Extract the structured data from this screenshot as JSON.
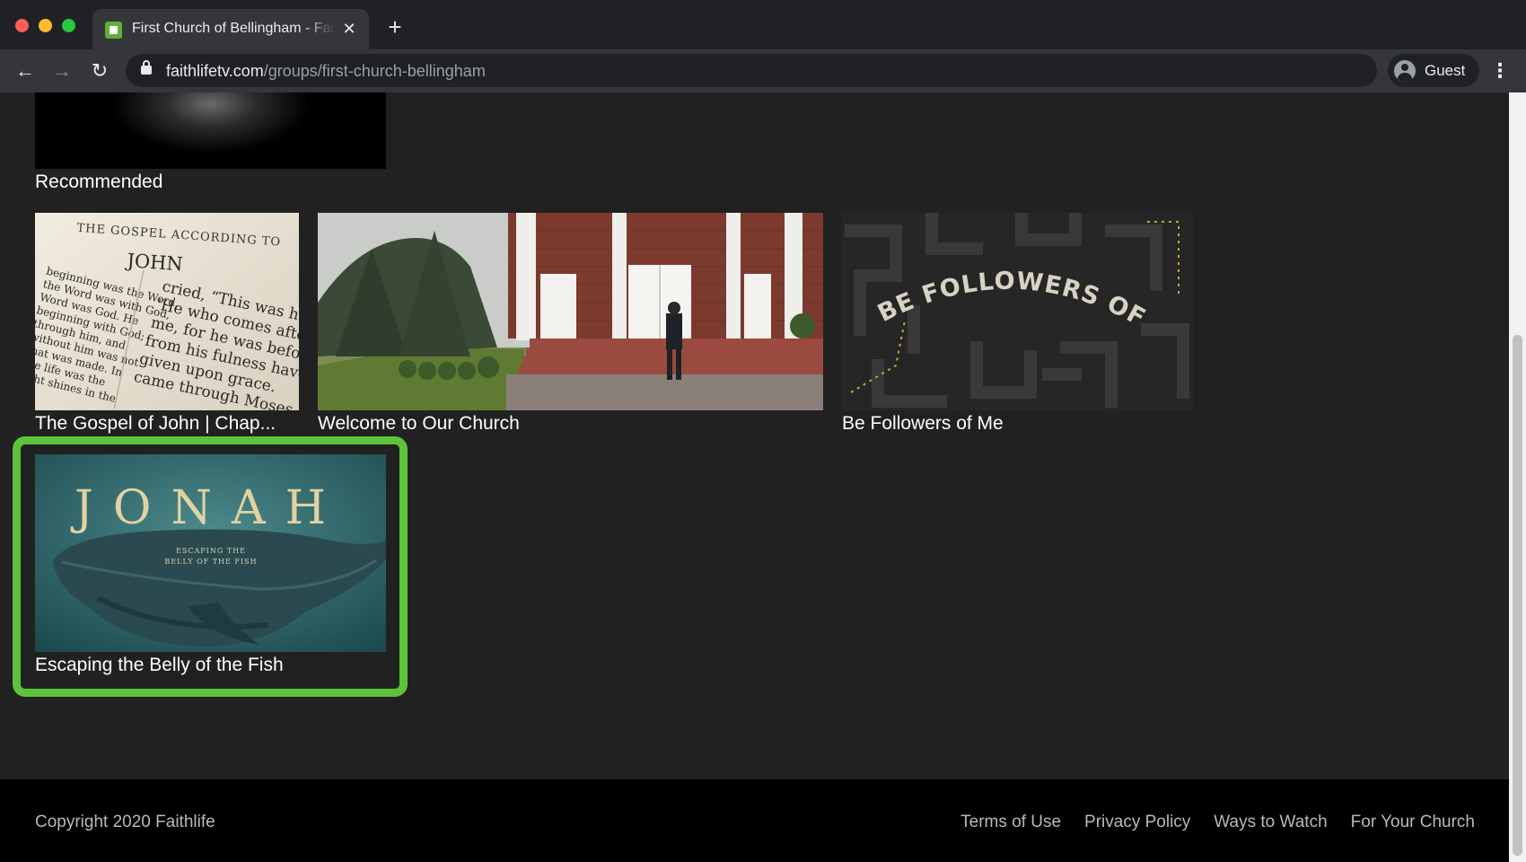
{
  "browser": {
    "tab_title": "First Church of Bellingham - Faithlife TV",
    "tab_close_glyph": "✕",
    "new_tab_glyph": "+",
    "url_domain": "faithlifetv.com",
    "url_path": "/groups/first-church-bellingham",
    "profile_label": "Guest",
    "back_glyph": "←",
    "forward_glyph": "→",
    "reload_glyph": "↻",
    "menu_glyph": "⋮"
  },
  "section": {
    "title": "Recommended"
  },
  "cards": [
    {
      "title": "The Gospel of John | Chap...",
      "art": "bible-page"
    },
    {
      "title": "Welcome to Our Church",
      "art": "church-entrance"
    },
    {
      "title": "Be Followers of Me",
      "art": "maze-lettering"
    },
    {
      "title": "Escaping the Belly of the Fish",
      "art": "whale-jonah",
      "highlighted": true
    }
  ],
  "thumb_text": {
    "bible_header": "THE GOSPEL ACCORDING TO",
    "bible_book": "JOHN",
    "bible_lines": [
      "cried, “This was he",
      "'He who comes after",
      "me, for he was before",
      "from his fulness have",
      "given upon grace.",
      "came through Moses."
    ],
    "bible_left_lines": [
      "beginning was the Word,",
      "the Word was with God,",
      "Word was God. He",
      "beginning with God;",
      "through him, and",
      "without him was not",
      "that was made. In",
      "the life was the",
      "light shines in the"
    ],
    "followers": "BE FOLLOWERS OF ME",
    "jonah_title": "JONAH",
    "jonah_sub1": "ESCAPING THE",
    "jonah_sub2": "BELLY OF THE FISH"
  },
  "footer": {
    "copyright": "Copyright 2020 Faithlife",
    "links": [
      "Terms of Use",
      "Privacy Policy",
      "Ways to Watch",
      "For Your Church"
    ]
  },
  "colors": {
    "highlight": "#5cc33a",
    "page_background": "#212121",
    "footer_background": "#000000"
  }
}
